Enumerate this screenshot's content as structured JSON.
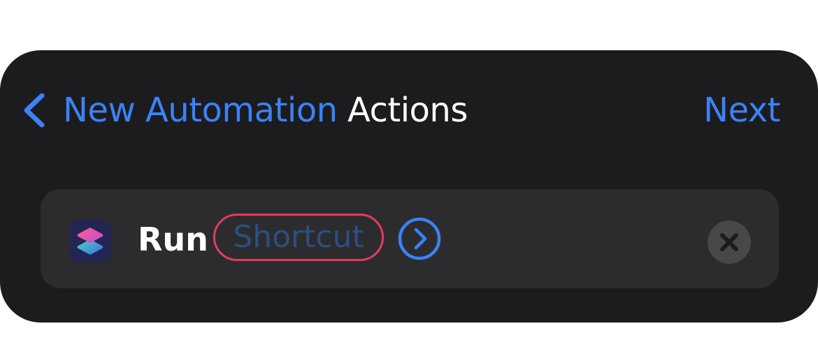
{
  "nav": {
    "back_label": "New Automation",
    "back_icon": "chevron-left-icon",
    "title": "Actions",
    "next_label": "Next"
  },
  "action": {
    "app_icon": "shortcuts-app-icon",
    "verb": "Run",
    "parameter_placeholder": "Shortcut",
    "expand_icon": "chevron-right-circle-icon",
    "remove_icon": "xmark-circle-icon"
  },
  "colors": {
    "accent": "#3b82f6",
    "panel_background": "#1c1c1e",
    "card_background": "#2c2c2e",
    "highlight_border": "#e63a5c",
    "placeholder_text": "#2b4f80"
  }
}
